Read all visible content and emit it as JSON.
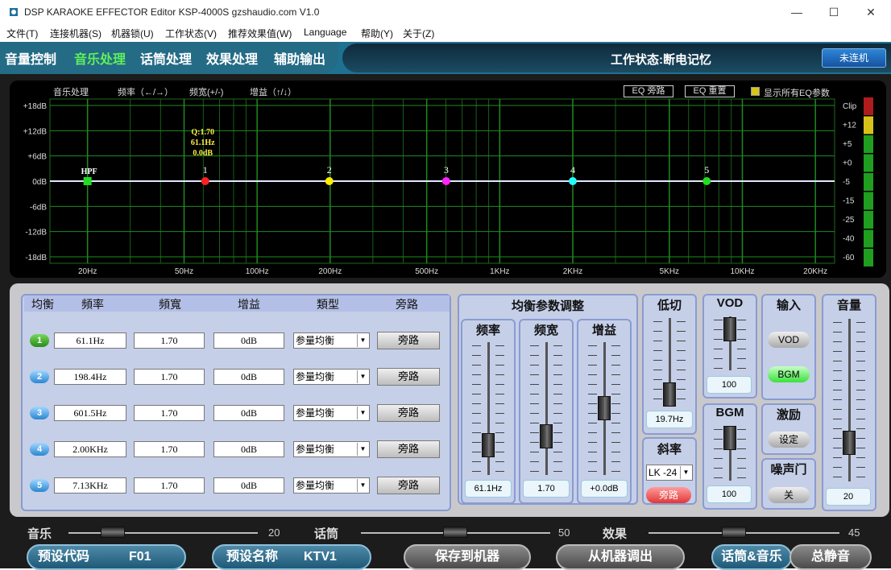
{
  "window": {
    "title": "DSP KARAOKE EFFECTOR Editor KSP-4000S    gzshaudio.com    V1.0",
    "minimize": "—",
    "maximize": "☐",
    "close": "✕"
  },
  "menu": [
    "文件(T)",
    "连接机器(S)",
    "机器锁(U)",
    "工作状态(V)",
    "推荐效果值(W)",
    "Language",
    "帮助(Y)",
    "关于(Z)"
  ],
  "tabs": [
    "音量控制",
    "音乐处理",
    "话筒处理",
    "效果处理",
    "辅助输出"
  ],
  "active_tab": "音乐处理",
  "status": "工作状态:断电记忆",
  "connect_button": "未连机",
  "eq": {
    "header": {
      "title": "音乐处理",
      "freq": "频率（←/→）",
      "width": "频宽(+/-)",
      "gain": "增益（↑/↓）"
    },
    "bypass_button": "EQ 旁路",
    "reset_button": "EQ 重置",
    "show_all_label": "显示所有EQ参数",
    "y_ticks": [
      "+18dB",
      "+12dB",
      "+6dB",
      "0dB",
      "-6dB",
      "-12dB",
      "-18dB"
    ],
    "x_ticks": [
      "20Hz",
      "50Hz",
      "100Hz",
      "200Hz",
      "500Hz",
      "1KHz",
      "2KHz",
      "5KHz",
      "10KHz",
      "20KHz"
    ],
    "points": [
      {
        "label": "HPF",
        "freq_hz": 20,
        "gain_db": 0,
        "color": "#22dd22"
      },
      {
        "label": "1",
        "freq_hz": 61.1,
        "gain_db": 0,
        "color": "#ff2222"
      },
      {
        "label": "2",
        "freq_hz": 198.4,
        "gain_db": 0,
        "color": "#ffee00"
      },
      {
        "label": "3",
        "freq_hz": 601.5,
        "gain_db": 0,
        "color": "#ff22ff"
      },
      {
        "label": "4",
        "freq_hz": 2000,
        "gain_db": 0,
        "color": "#22ffff"
      },
      {
        "label": "5",
        "freq_hz": 7130,
        "gain_db": 0,
        "color": "#22dd22"
      }
    ],
    "tooltip": [
      "Q:1.70",
      "61.1Hz",
      "0.0dB"
    ],
    "meter_labels": [
      "Clip",
      "+12",
      "+5",
      "+0",
      "-5",
      "-15",
      "-25",
      "-40",
      "-60"
    ]
  },
  "eq_table": {
    "headers": [
      "均衡",
      "頻率",
      "頻寬",
      "增益",
      "類型",
      "旁路"
    ],
    "rows": [
      {
        "num": "1",
        "freq": "61.1Hz",
        "width": "1.70",
        "gain": "0dB",
        "type": "参量均衡",
        "bypass": "旁路"
      },
      {
        "num": "2",
        "freq": "198.4Hz",
        "width": "1.70",
        "gain": "0dB",
        "type": "参量均衡",
        "bypass": "旁路"
      },
      {
        "num": "3",
        "freq": "601.5Hz",
        "width": "1.70",
        "gain": "0dB",
        "type": "参量均衡",
        "bypass": "旁路"
      },
      {
        "num": "4",
        "freq": "2.00KHz",
        "width": "1.70",
        "gain": "0dB",
        "type": "参量均衡",
        "bypass": "旁路"
      },
      {
        "num": "5",
        "freq": "7.13KHz",
        "width": "1.70",
        "gain": "0dB",
        "type": "参量均衡",
        "bypass": "旁路"
      }
    ]
  },
  "adjust": {
    "title": "均衡参数调整",
    "freq_label": "频率",
    "width_label": "频宽",
    "gain_label": "增益",
    "freq_value": "61.1Hz",
    "width_value": "1.70",
    "gain_value": "+0.0dB"
  },
  "lowcut": {
    "title": "低切",
    "value": "19.7Hz",
    "slope_title": "斜率",
    "slope_value": "LK -24",
    "bypass": "旁路"
  },
  "vod": {
    "title": "VOD",
    "value": "100"
  },
  "bgm": {
    "title": "BGM",
    "value": "100"
  },
  "input": {
    "title": "输入",
    "vod_button": "VOD",
    "bgm_button": "BGM"
  },
  "exciter": {
    "title": "激励",
    "button": "设定"
  },
  "noise_gate": {
    "title": "噪声门",
    "button": "关"
  },
  "volume": {
    "title": "音量",
    "value": "20"
  },
  "bottom": {
    "music_label": "音乐",
    "music_value": "20",
    "mic_label": "话筒",
    "mic_value": "50",
    "effect_label": "效果",
    "effect_value": "45",
    "preset_code_label": "预设代码",
    "preset_code": "F01",
    "preset_name_label": "预设名称",
    "preset_name": "KTV1",
    "save_button": "保存到机器",
    "load_button": "从机器调出",
    "mic_music_button": "话筒&音乐",
    "mute_button": "总静音"
  },
  "colors": {
    "accent": "#5ff05a",
    "tabbar": "#1f7191",
    "panel": "#c5cfe8",
    "border": "#8a9bd2"
  }
}
